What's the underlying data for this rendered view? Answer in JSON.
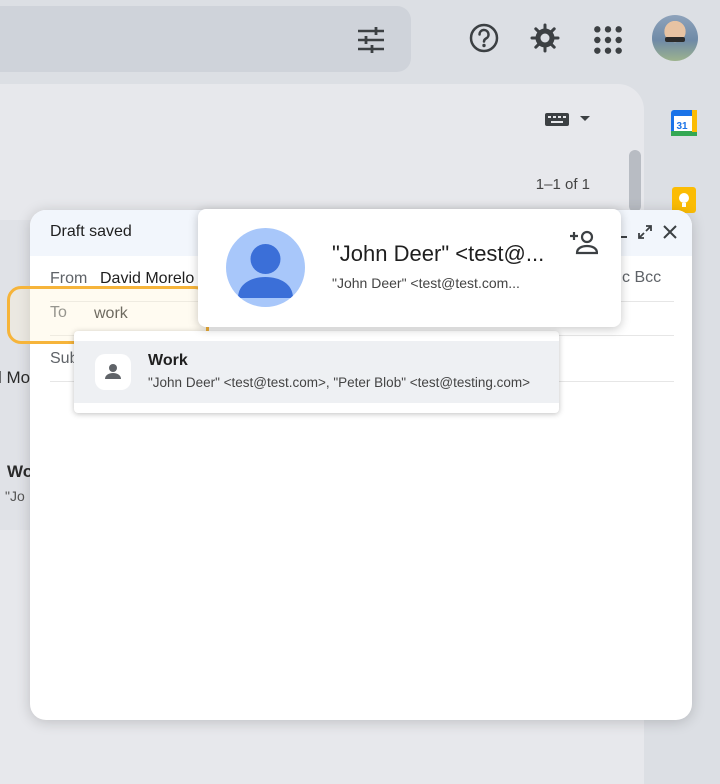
{
  "header": {
    "icons": [
      "filter-icon",
      "help-icon",
      "settings-icon",
      "apps-icon",
      "avatar"
    ]
  },
  "mail_list": {
    "pagination": "1–1 of 1",
    "partial_row_text_1": "l Mo",
    "partial_row_text_2": "Wo",
    "partial_row_text_3": "\"Jo"
  },
  "compose": {
    "title": "Draft saved",
    "from_label": "From",
    "from_value": "David Morelo",
    "to_label": "To",
    "to_value": "work",
    "cc_bcc": "c  Bcc",
    "subject_label": "Sub"
  },
  "suggestion": {
    "name": "Work",
    "members": "\"John Deer\" <test@test.com>, \"Peter Blob\" <test@testing.com>"
  },
  "contact_card": {
    "name": "\"John Deer\" <test@...",
    "email": "\"John Deer\" <test@test.com..."
  },
  "colors": {
    "highlight": "#f6b43a",
    "compose_header": "#f2f6fc",
    "avatar_bg": "#a8c7fa",
    "avatar_fg": "#3b6fd8"
  }
}
